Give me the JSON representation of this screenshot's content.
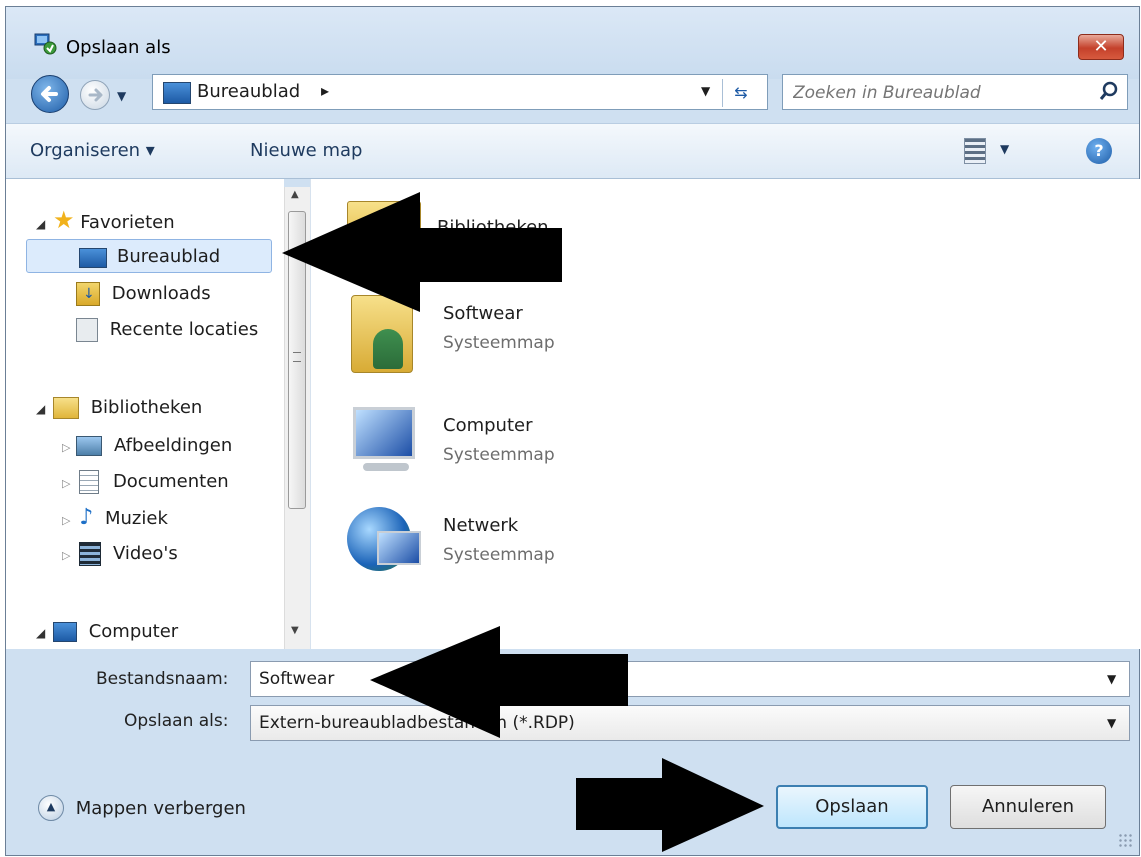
{
  "window": {
    "title": "Opslaan als",
    "close_label": "✕"
  },
  "address": {
    "location": "Bureaublad",
    "separator": "▸",
    "search_placeholder": "Zoeken in Bureaublad"
  },
  "toolbar": {
    "organize_label": "Organiseren ▾",
    "new_folder_label": "Nieuwe map"
  },
  "sidebar": {
    "favorites": {
      "label": "Favorieten",
      "items": [
        {
          "label": "Bureaublad",
          "icon": "desktop-icon",
          "selected": true
        },
        {
          "label": "Downloads",
          "icon": "downloads-icon"
        },
        {
          "label": "Recente locaties",
          "icon": "recent-places-icon"
        }
      ]
    },
    "libraries": {
      "label": "Bibliotheken",
      "items": [
        {
          "label": "Afbeeldingen",
          "icon": "pictures-icon"
        },
        {
          "label": "Documenten",
          "icon": "documents-icon"
        },
        {
          "label": "Muziek",
          "icon": "music-icon"
        },
        {
          "label": "Video's",
          "icon": "video-icon"
        }
      ]
    },
    "computer": {
      "label": "Computer"
    }
  },
  "content": {
    "items": [
      {
        "name": "Bibliotheken",
        "type": "",
        "icon": "library-folder-icon"
      },
      {
        "name": "Softwear",
        "type": "Systeemmap",
        "icon": "user-folder-icon"
      },
      {
        "name": "Computer",
        "type": "Systeemmap",
        "icon": "computer-icon"
      },
      {
        "name": "Netwerk",
        "type": "Systeemmap",
        "icon": "network-icon"
      }
    ]
  },
  "form": {
    "filename_label": "Bestandsnaam:",
    "filename_value": "Softwear",
    "savetype_label": "Opslaan als:",
    "savetype_value": "Extern-bureaubladbestanden (*.RDP)"
  },
  "footer": {
    "hide_folders_label": "Mappen verbergen",
    "save_label": "Opslaan",
    "cancel_label": "Annuleren"
  },
  "colors": {
    "accent": "#3c7fb1",
    "selection": "#dcebfc",
    "window_frame": "#cfe0f1",
    "annotation_arrow": "#000000"
  }
}
